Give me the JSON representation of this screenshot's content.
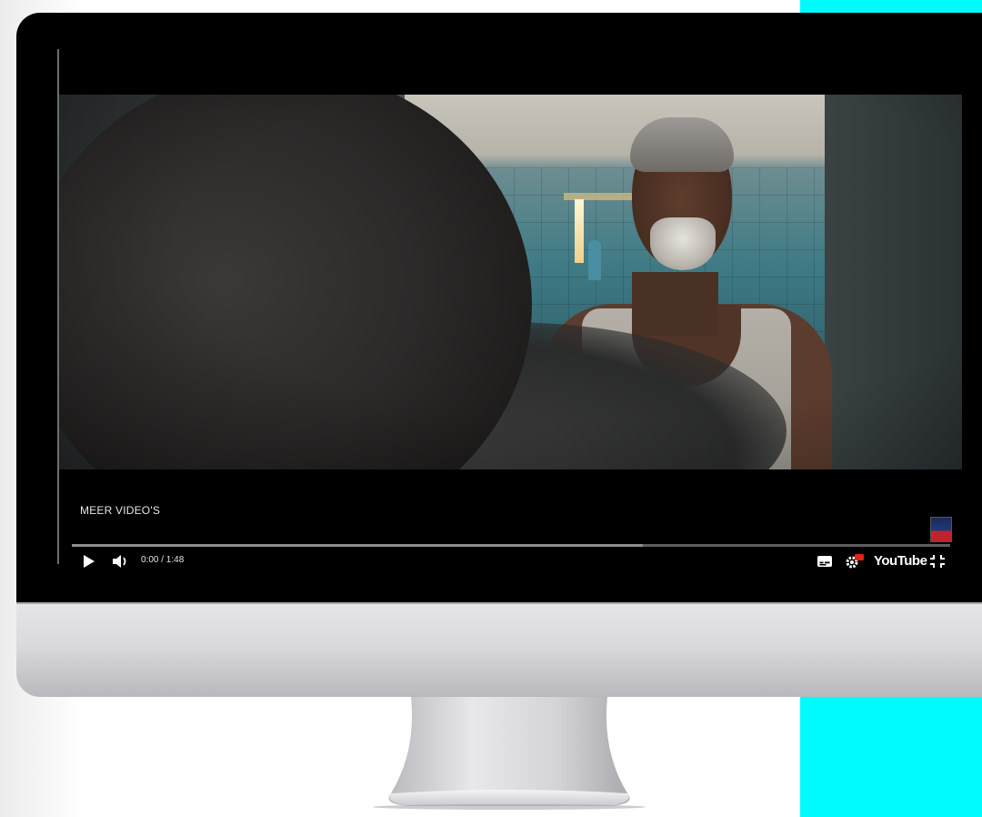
{
  "player": {
    "more_videos_label": "MEER VIDEO'S",
    "time_display": "0:00 / 1:48",
    "progress_fraction": 0.65,
    "logo_text": "YouTube"
  },
  "colors": {
    "accent_band": "#00fbff",
    "bezel": "#000000",
    "chin": "#dadade"
  },
  "icons": {
    "play": "play-icon",
    "volume": "volume-icon",
    "captions": "captions-icon",
    "settings": "settings-icon",
    "exit_fullscreen": "exit-fullscreen-icon",
    "channel": "channel-thumbnail"
  }
}
